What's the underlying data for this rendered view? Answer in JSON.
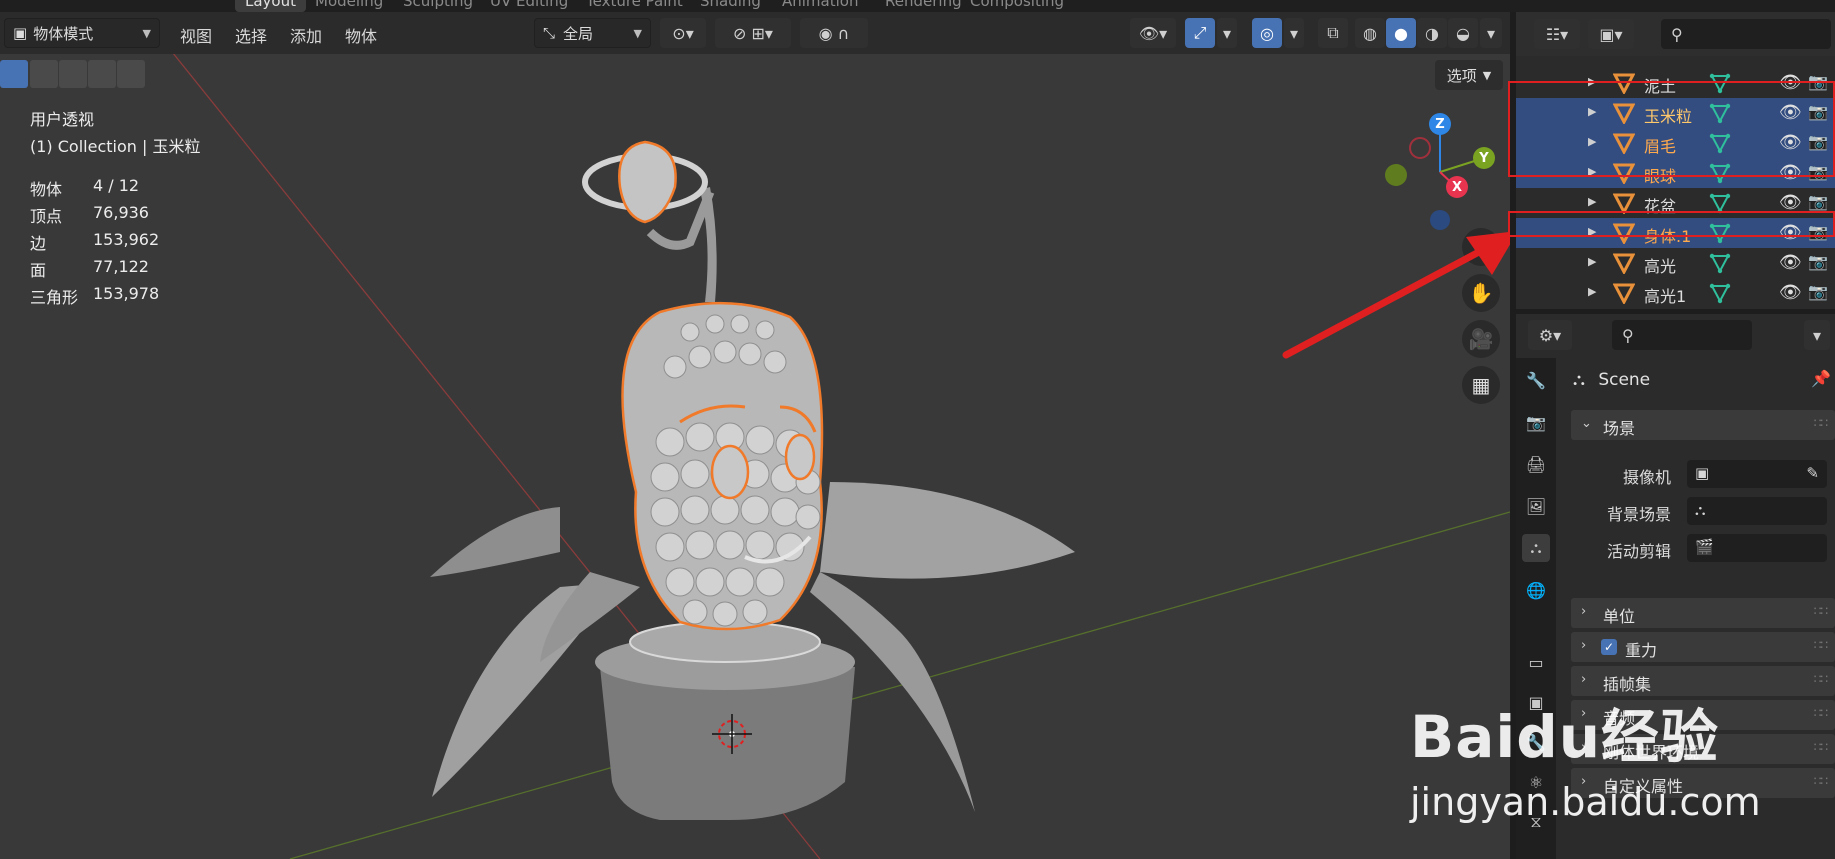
{
  "workspace_tabs": [
    "Layout",
    "Modeling",
    "Sculpting",
    "UV Editing",
    "Texture Paint",
    "Shading",
    "Animation",
    "Rendering",
    "Compositing"
  ],
  "viewport": {
    "mode": "物体模式",
    "menus": [
      "视图",
      "选择",
      "添加",
      "物体"
    ],
    "transform_orientation": "全局",
    "options_label": "选项",
    "view_name": "用户透视",
    "collection_info": "(1) Collection | 玉米粒",
    "stats": [
      {
        "label": "物体",
        "value": "4 / 12"
      },
      {
        "label": "顶点",
        "value": "76,936"
      },
      {
        "label": "边",
        "value": "153,962"
      },
      {
        "label": "面",
        "value": "77,122"
      },
      {
        "label": "三角形",
        "value": "153,978"
      }
    ],
    "gizmo_axes": {
      "z": "Z",
      "y": "Y",
      "x": "X"
    },
    "colors": {
      "x_axis": "#e8344f",
      "y_axis": "#7aa321",
      "z_axis": "#2e87e6",
      "selection_outline": "#f07a2a"
    }
  },
  "outliner": {
    "rows": [
      {
        "name": "泥土",
        "selected": false
      },
      {
        "name": "玉米粒",
        "selected": true,
        "active": true
      },
      {
        "name": "眉毛",
        "selected": true
      },
      {
        "name": "眼球",
        "selected": true
      },
      {
        "name": "花盆",
        "selected": false
      },
      {
        "name": "身体.1",
        "selected": true
      },
      {
        "name": "高光",
        "selected": false
      },
      {
        "name": "高光1",
        "selected": false
      }
    ]
  },
  "properties": {
    "header_title": "Scene",
    "scene_panel_title": "场景",
    "fields": [
      {
        "label": "摄像机"
      },
      {
        "label": "背景场景"
      },
      {
        "label": "活动剪辑"
      }
    ],
    "panels": [
      "单位",
      "重力",
      "插帧集",
      "音频",
      "刚体世界环境",
      "自定义属性"
    ]
  },
  "watermark": {
    "brand": "Baidu经验",
    "url": "jingyan.baidu.com"
  }
}
